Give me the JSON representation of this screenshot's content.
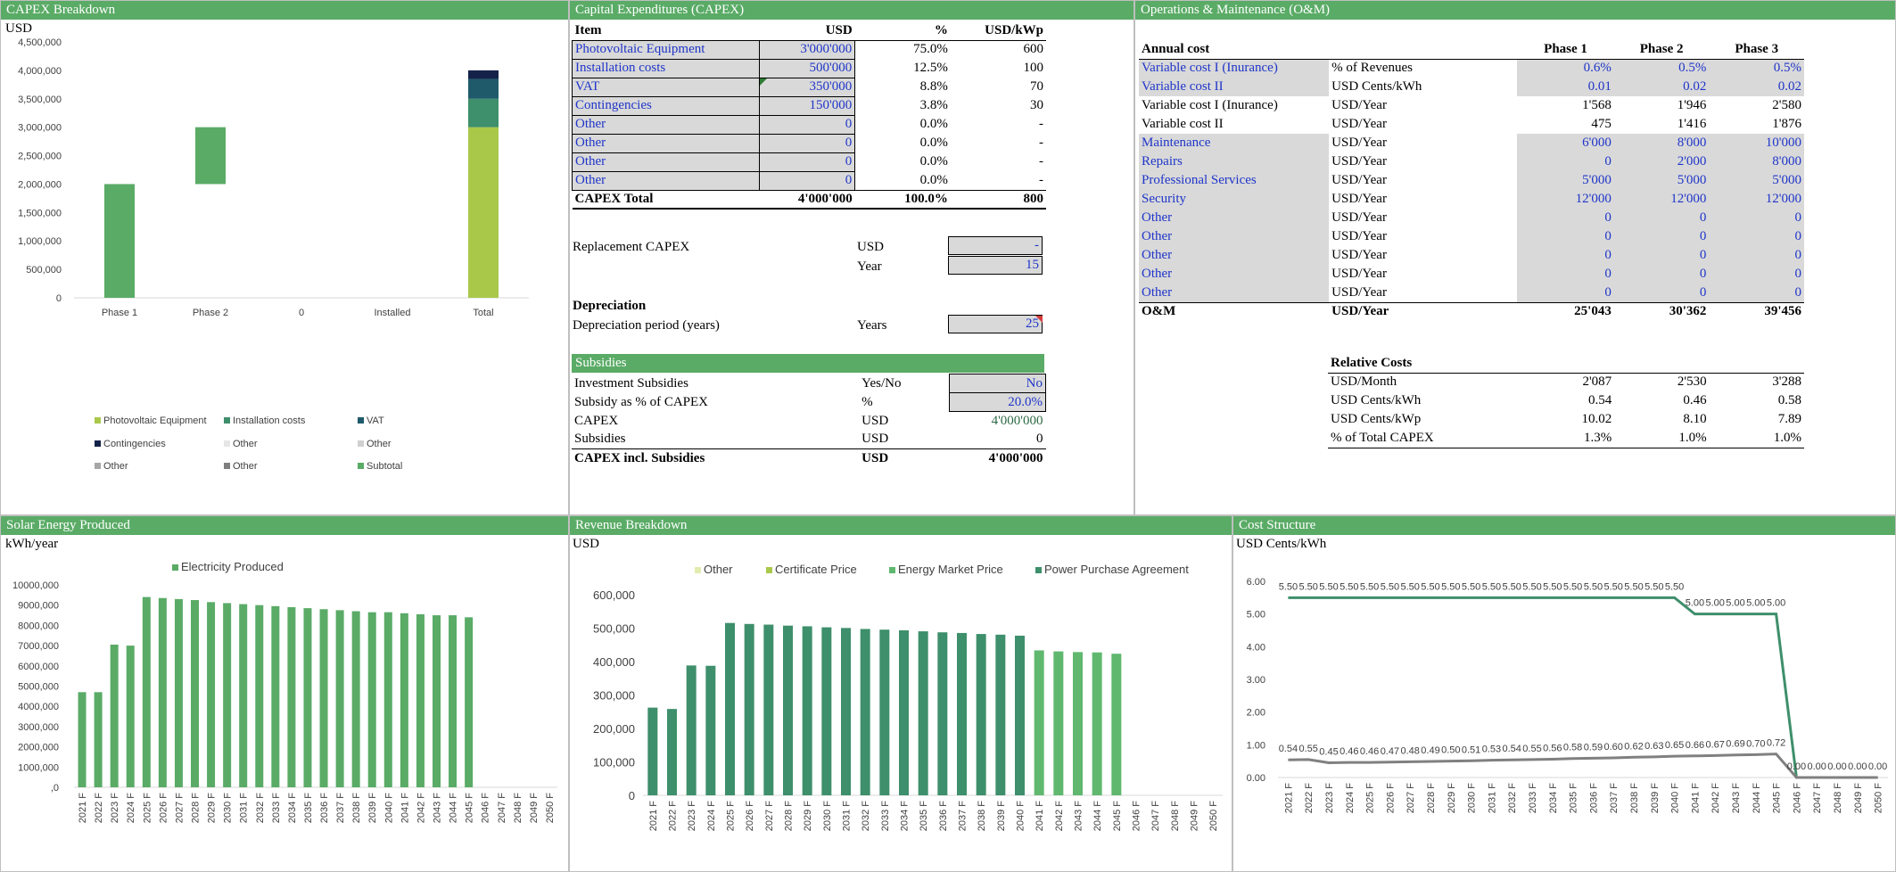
{
  "capex_breakdown": {
    "title": "CAPEX Breakdown",
    "unit": "USD",
    "chart_data": {
      "type": "bar",
      "stacked": true,
      "categories": [
        "Phase 1",
        "Phase 2",
        "0",
        "Installed",
        "Total"
      ],
      "yticks": [
        "4,500,000",
        "4,000,000",
        "3,500,000",
        "3,000,000",
        "2,500,000",
        "2,000,000",
        "1,500,000",
        "1,000,000",
        "500,000",
        "0"
      ],
      "ylim": [
        0,
        4500000
      ],
      "segments": [
        {
          "category": "Phase 1",
          "from": 0,
          "to": 2000000,
          "series": "Subtotal",
          "color": "#5aab66"
        },
        {
          "category": "Phase 2",
          "from": 2000000,
          "to": 3000000,
          "series": "Subtotal",
          "color": "#5aab66"
        },
        {
          "category": "Total",
          "from": 0,
          "to": 3000000,
          "series": "Photovoltaic Equipment",
          "color": "#a9c84a"
        },
        {
          "category": "Total",
          "from": 3000000,
          "to": 3500000,
          "series": "Installation costs",
          "color": "#3e8f6b"
        },
        {
          "category": "Total",
          "from": 3500000,
          "to": 3850000,
          "series": "VAT",
          "color": "#1f5a6b"
        },
        {
          "category": "Total",
          "from": 3850000,
          "to": 4000000,
          "series": "Contingencies",
          "color": "#14224a"
        }
      ],
      "legend": [
        {
          "name": "Photovoltaic Equipment",
          "color": "#a9c84a"
        },
        {
          "name": "Installation costs",
          "color": "#3e8f6b"
        },
        {
          "name": "VAT",
          "color": "#1f5a6b"
        },
        {
          "name": "Contingencies",
          "color": "#14224a"
        },
        {
          "name": "Other",
          "color": "#e6e6e6"
        },
        {
          "name": "Other",
          "color": "#d0d0d0"
        },
        {
          "name": "Other",
          "color": "#a6a6a6"
        },
        {
          "name": "Other",
          "color": "#7f7f7f"
        },
        {
          "name": "Subtotal",
          "color": "#5aab66"
        }
      ]
    }
  },
  "capex": {
    "title": "Capital Expenditures (CAPEX)",
    "headers": [
      "Item",
      "USD",
      "%",
      "USD/kWp"
    ],
    "rows": [
      [
        "Photovoltaic Equipment",
        "3'000'000",
        "75.0%",
        "600"
      ],
      [
        "Installation costs",
        "500'000",
        "12.5%",
        "100"
      ],
      [
        "VAT",
        "350'000",
        "8.8%",
        "70"
      ],
      [
        "Contingencies",
        "150'000",
        "3.8%",
        "30"
      ],
      [
        "Other",
        "0",
        "0.0%",
        "-"
      ],
      [
        "Other",
        "0",
        "0.0%",
        "-"
      ],
      [
        "Other",
        "0",
        "0.0%",
        "-"
      ],
      [
        "Other",
        "0",
        "0.0%",
        "-"
      ]
    ],
    "total": [
      "CAPEX Total",
      "4'000'000",
      "100.0%",
      "800"
    ],
    "replacement_label": "Replacement CAPEX",
    "replacement_unit1": "USD",
    "replacement_value1": "-",
    "replacement_unit2": "Year",
    "replacement_value2": "15",
    "depreciation_heading": "Depreciation",
    "depreciation_label": "Depreciation period (years)",
    "depreciation_unit": "Years",
    "depreciation_value": "25",
    "subsidies_heading": "Subsidies",
    "subsidies_rows": [
      [
        "Investment Subsidies",
        "Yes/No",
        "No"
      ],
      [
        "Subsidy as % of CAPEX",
        "%",
        "20.0%"
      ],
      [
        "CAPEX",
        "USD",
        "4'000'000"
      ],
      [
        "Subsidies",
        "USD",
        "0"
      ]
    ],
    "subsidies_total": [
      "CAPEX incl. Subsidies",
      "USD",
      "4'000'000"
    ]
  },
  "om": {
    "title": "Operations & Maintenance (O&M)",
    "headers": [
      "Annual cost",
      "",
      "Phase 1",
      "Phase 2",
      "Phase 3"
    ],
    "rows": [
      [
        "Variable cost I (Inurance)",
        "% of Revenues",
        "0.6%",
        "0.5%",
        "0.5%"
      ],
      [
        "Variable cost II",
        "USD Cents/kWh",
        "0.01",
        "0.02",
        "0.02"
      ],
      [
        "Variable cost I (Inurance)",
        "USD/Year",
        "1'568",
        "1'946",
        "2'580"
      ],
      [
        "Variable cost II",
        "USD/Year",
        "475",
        "1'416",
        "1'876"
      ],
      [
        "Maintenance",
        "USD/Year",
        "6'000",
        "8'000",
        "10'000"
      ],
      [
        "Repairs",
        "USD/Year",
        "0",
        "2'000",
        "8'000"
      ],
      [
        "Professional Services",
        "USD/Year",
        "5'000",
        "5'000",
        "5'000"
      ],
      [
        "Security",
        "USD/Year",
        "12'000",
        "12'000",
        "12'000"
      ],
      [
        "Other",
        "USD/Year",
        "0",
        "0",
        "0"
      ],
      [
        "Other",
        "USD/Year",
        "0",
        "0",
        "0"
      ],
      [
        "Other",
        "USD/Year",
        "0",
        "0",
        "0"
      ],
      [
        "Other",
        "USD/Year",
        "0",
        "0",
        "0"
      ],
      [
        "Other",
        "USD/Year",
        "0",
        "0",
        "0"
      ]
    ],
    "total": [
      "O&M",
      "USD/Year",
      "25'043",
      "30'362",
      "39'456"
    ],
    "relative_heading": "Relative Costs",
    "relative_rows": [
      [
        "USD/Month",
        "2'087",
        "2'530",
        "3'288"
      ],
      [
        "USD Cents/kWh",
        "0.54",
        "0.46",
        "0.58"
      ],
      [
        "USD Cents/kWp",
        "10.02",
        "8.10",
        "7.89"
      ],
      [
        "% of Total CAPEX",
        "1.3%",
        "1.0%",
        "1.0%"
      ]
    ]
  },
  "solar": {
    "title": "Solar Energy Produced",
    "unit": "kWh/year",
    "chart_data": {
      "type": "bar",
      "legend": "Electricity Produced",
      "color": "#5aab66",
      "yticks": [
        "10000,000",
        "9000,000",
        "8000,000",
        "7000,000",
        "6000,000",
        "5000,000",
        "4000,000",
        "3000,000",
        "2000,000",
        "1000,000",
        ",0"
      ],
      "ylim": [
        0,
        10000000
      ],
      "categories": [
        "2021 F",
        "2022 F",
        "2023 F",
        "2024 F",
        "2025 F",
        "2026 F",
        "2027 F",
        "2028 F",
        "2029 F",
        "2030 F",
        "2031 F",
        "2032 F",
        "2033 F",
        "2034 F",
        "2035 F",
        "2036 F",
        "2037 F",
        "2038 F",
        "2039 F",
        "2040 F",
        "2041 F",
        "2042 F",
        "2043 F",
        "2044 F",
        "2045 F",
        "2046 F",
        "2047 F",
        "2048 F",
        "2049 F",
        "2050 F"
      ],
      "values": [
        4700000,
        4700000,
        7050000,
        7000000,
        9400000,
        9350000,
        9300000,
        9250000,
        9150000,
        9100000,
        9050000,
        9000000,
        8950000,
        8900000,
        8850000,
        8800000,
        8750000,
        8700000,
        8650000,
        8650000,
        8600000,
        8550000,
        8500000,
        8500000,
        8400000,
        0,
        0,
        0,
        0,
        0
      ]
    }
  },
  "revenue": {
    "title": "Revenue Breakdown",
    "unit": "USD",
    "chart_data": {
      "type": "bar",
      "stacked": true,
      "legend": [
        {
          "name": "Other",
          "color": "#e3ecb0"
        },
        {
          "name": "Certificate Price",
          "color": "#a9c84a"
        },
        {
          "name": "Energy Market Price",
          "color": "#5fb86e"
        },
        {
          "name": "Power Purchase Agreement",
          "color": "#3e8f6b"
        }
      ],
      "yticks": [
        "600,000",
        "500,000",
        "400,000",
        "300,000",
        "200,000",
        "100,000",
        "0"
      ],
      "ylim": [
        0,
        650000
      ],
      "categories": [
        "2021 F",
        "2022 F",
        "2023 F",
        "2024 F",
        "2025 F",
        "2026 F",
        "2027 F",
        "2028 F",
        "2029 F",
        "2030 F",
        "2031 F",
        "2032 F",
        "2033 F",
        "2034 F",
        "2035 F",
        "2036 F",
        "2037 F",
        "2038 F",
        "2039 F",
        "2040 F",
        "2041 F",
        "2042 F",
        "2043 F",
        "2044 F",
        "2045 F",
        "2046 F",
        "2047 F",
        "2048 F",
        "2049 F",
        "2050 F"
      ],
      "series": [
        {
          "name": "Power Purchase Agreement",
          "values": [
            262000,
            258000,
            388000,
            387000,
            515000,
            512000,
            510000,
            507000,
            505000,
            502000,
            500000,
            497000,
            495000,
            493000,
            490000,
            487000,
            485000,
            482000,
            480000,
            477000,
            0,
            0,
            0,
            0,
            0,
            0,
            0,
            0,
            0,
            0
          ]
        },
        {
          "name": "Energy Market Price",
          "values": [
            0,
            0,
            0,
            0,
            0,
            0,
            0,
            0,
            0,
            0,
            0,
            0,
            0,
            0,
            0,
            0,
            0,
            0,
            0,
            0,
            433000,
            430000,
            428000,
            427000,
            423000,
            0,
            0,
            0,
            0,
            0
          ]
        }
      ]
    }
  },
  "cost": {
    "title": "Cost Structure",
    "unit": "USD Cents/kWh",
    "chart_data": {
      "type": "line",
      "yticks": [
        "6.00",
        "5.00",
        "4.00",
        "3.00",
        "2.00",
        "1.00",
        "0.00"
      ],
      "ylim": [
        0,
        6
      ],
      "categories": [
        "2021 F",
        "2022 F",
        "2023 F",
        "2024 F",
        "2025 F",
        "2026 F",
        "2027 F",
        "2028 F",
        "2029 F",
        "2030 F",
        "2031 F",
        "2032 F",
        "2033 F",
        "2034 F",
        "2035 F",
        "2036 F",
        "2037 F",
        "2038 F",
        "2039 F",
        "2040 F",
        "2041 F",
        "2042 F",
        "2043 F",
        "2044 F",
        "2045 F",
        "2046 F",
        "2047 F",
        "2048 F",
        "2049 F",
        "2050 F"
      ],
      "series": [
        {
          "color": "#3e8f6b",
          "values": [
            5.5,
            5.5,
            5.5,
            5.5,
            5.5,
            5.5,
            5.5,
            5.5,
            5.5,
            5.5,
            5.5,
            5.5,
            5.5,
            5.5,
            5.5,
            5.5,
            5.5,
            5.5,
            5.5,
            5.5,
            5.0,
            5.0,
            5.0,
            5.0,
            5.0,
            0,
            0,
            0,
            0,
            0
          ],
          "labels": [
            "5.50",
            "5.50",
            "5.50",
            "5.50",
            "5.50",
            "5.50",
            "5.50",
            "5.50",
            "5.50",
            "5.50",
            "5.50",
            "5.50",
            "5.50",
            "5.50",
            "5.50",
            "5.50",
            "5.50",
            "5.50",
            "5.50",
            "5.50",
            "5.00",
            "5.00",
            "5.00",
            "5.00",
            "5.00",
            "",
            "",
            "",
            "",
            ""
          ]
        },
        {
          "color": "#808080",
          "values": [
            0.54,
            0.55,
            0.45,
            0.46,
            0.46,
            0.47,
            0.48,
            0.49,
            0.5,
            0.51,
            0.53,
            0.54,
            0.55,
            0.56,
            0.58,
            0.59,
            0.6,
            0.62,
            0.63,
            0.65,
            0.66,
            0.67,
            0.69,
            0.7,
            0.72,
            0,
            0,
            0,
            0,
            0
          ],
          "labels": [
            "0.54",
            "0.55",
            "0.45",
            "0.46",
            "0.46",
            "0.47",
            "0.48",
            "0.49",
            "0.50",
            "0.51",
            "0.53",
            "0.54",
            "0.55",
            "0.56",
            "0.58",
            "0.59",
            "0.60",
            "0.62",
            "0.63",
            "0.65",
            "0.66",
            "0.67",
            "0.69",
            "0.70",
            "0.72",
            "0.00",
            "0.00",
            "0.00",
            "0.00",
            "0.00"
          ]
        }
      ]
    }
  }
}
